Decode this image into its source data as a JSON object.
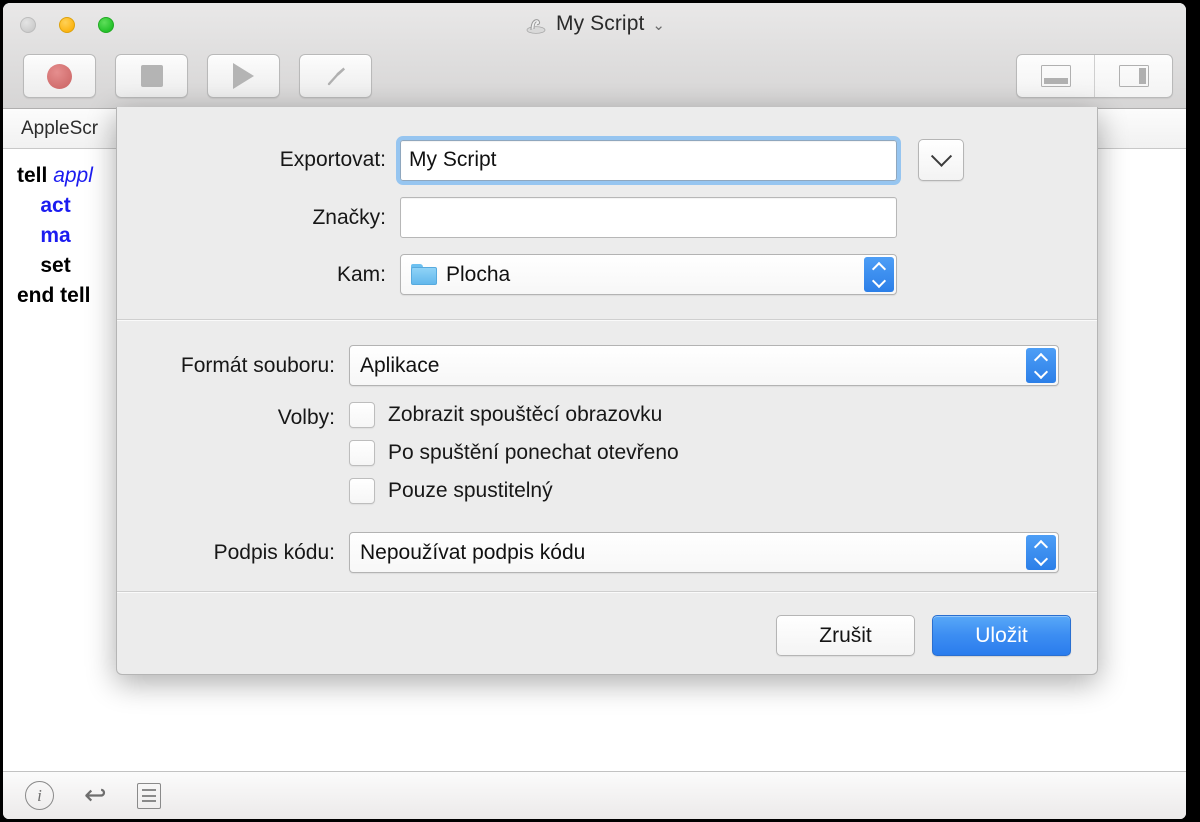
{
  "window": {
    "title": "My Script",
    "title_icon": "applescript-document-icon",
    "title_chevron": "⌄",
    "traffic_lights": [
      "close-button",
      "minimize-button",
      "zoom-button"
    ]
  },
  "toolbar": {
    "buttons": [
      {
        "name": "record-button",
        "icon": "record-circle-icon"
      },
      {
        "name": "stop-button",
        "icon": "stop-square-icon"
      },
      {
        "name": "run-button",
        "icon": "play-triangle-icon"
      },
      {
        "name": "compile-button",
        "icon": "hammer-icon"
      }
    ],
    "view_segments": [
      {
        "name": "show-bottom-panel-button",
        "icon": "panel-bottom-icon"
      },
      {
        "name": "show-right-panel-button",
        "icon": "panel-right-icon"
      }
    ]
  },
  "editor": {
    "tab_label": "AppleScr",
    "code_lines": [
      {
        "parts": [
          {
            "t": "tell ",
            "c": "kw"
          },
          {
            "t": "appl",
            "c": "app-ref"
          }
        ]
      },
      {
        "parts": [
          {
            "t": "    act",
            "c": "cmd"
          }
        ]
      },
      {
        "parts": [
          {
            "t": "    ma",
            "c": "cmd"
          }
        ]
      },
      {
        "parts": [
          {
            "t": "    set",
            "c": "kw"
          }
        ]
      },
      {
        "parts": [
          {
            "t": "end tell",
            "c": "kw"
          }
        ]
      }
    ]
  },
  "statusbar": {
    "icons": [
      {
        "name": "info-icon",
        "glyph": "i"
      },
      {
        "name": "return-arrow-icon",
        "glyph": "↩"
      },
      {
        "name": "description-list-icon",
        "glyph": "list"
      }
    ]
  },
  "dialog": {
    "export_label": "Exportovat:",
    "export_value": "My Script",
    "expand_icon": "chevron-down-icon",
    "tags_label": "Značky:",
    "tags_value": "",
    "where_label": "Kam:",
    "where_value": "Plocha",
    "where_icon": "folder-icon",
    "format_label": "Formát souboru:",
    "format_value": "Aplikace",
    "options_label": "Volby:",
    "options": [
      {
        "label": "Zobrazit spouštěcí obrazovku",
        "checked": false
      },
      {
        "label": "Po spuštění ponechat otevřeno",
        "checked": false
      },
      {
        "label": "Pouze spustitelný",
        "checked": false
      }
    ],
    "codesign_label": "Podpis kódu:",
    "codesign_value": "Nepoužívat podpis kódu",
    "cancel_label": "Zrušit",
    "save_label": "Uložit"
  },
  "colors": {
    "accent_blue": "#2a7ced",
    "focus_ring": "#96c5f0",
    "stepper_blue": "#3d8ef2",
    "code_blue": "#1c1cf0",
    "sheet_bg": "#ececec"
  }
}
